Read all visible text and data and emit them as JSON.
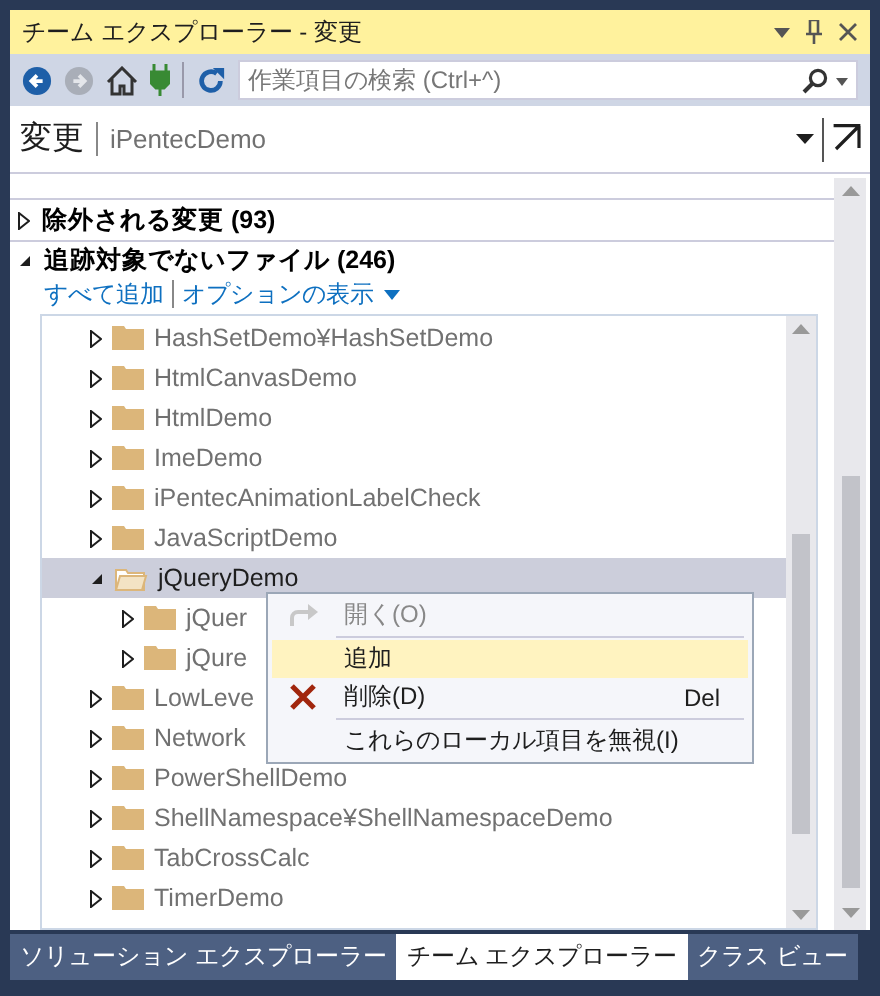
{
  "window": {
    "title": "チーム エクスプローラー - 変更"
  },
  "search": {
    "placeholder": "作業項目の検索 (Ctrl+^)"
  },
  "header": {
    "title": "変更",
    "repository": "iPentecDemo"
  },
  "sections": [
    {
      "label": "除外される変更 (93)",
      "expanded": false
    },
    {
      "label": "追跡対象でないファイル (246)",
      "expanded": true,
      "links": [
        "すべて追加",
        "オプションの表示"
      ]
    }
  ],
  "tree": [
    {
      "label": "HashSetDemo¥HashSetDemo",
      "expanded": false,
      "selected": false
    },
    {
      "label": "HtmlCanvasDemo",
      "expanded": false,
      "selected": false
    },
    {
      "label": "HtmlDemo",
      "expanded": false,
      "selected": false
    },
    {
      "label": "ImeDemo",
      "expanded": false,
      "selected": false
    },
    {
      "label": "iPentecAnimationLabelCheck",
      "expanded": false,
      "selected": false
    },
    {
      "label": "JavaScriptDemo",
      "expanded": false,
      "selected": false
    },
    {
      "label": "jQueryDemo",
      "expanded": true,
      "selected": true,
      "children": [
        {
          "label": "jQuer",
          "expanded": false,
          "selected": false
        },
        {
          "label": "jQure",
          "expanded": false,
          "selected": false
        }
      ]
    },
    {
      "label": "LowLeve",
      "expanded": false,
      "selected": false
    },
    {
      "label": "Network",
      "expanded": false,
      "selected": false
    },
    {
      "label": "PowerShellDemo",
      "expanded": false,
      "selected": false
    },
    {
      "label": "ShellNamespace¥ShellNamespaceDemo",
      "expanded": false,
      "selected": false
    },
    {
      "label": "TabCrossCalc",
      "expanded": false,
      "selected": false
    },
    {
      "label": "TimerDemo",
      "expanded": false,
      "selected": false
    }
  ],
  "context_menu": [
    {
      "label": "開く(O)",
      "kind": "redo",
      "disabled": true,
      "selected": false,
      "separator_after": true
    },
    {
      "label": "追加",
      "kind": "plain",
      "disabled": false,
      "selected": true,
      "separator_after": false
    },
    {
      "label": "削除(D)",
      "kind": "delete",
      "shortcut": "Del",
      "disabled": false,
      "selected": false,
      "separator_after": true
    },
    {
      "label": "これらのローカル項目を無視(I)",
      "kind": "plain",
      "disabled": false,
      "selected": false,
      "separator_after": false
    }
  ],
  "tabs": [
    {
      "label": "ソリューション エクスプローラー",
      "selected": false
    },
    {
      "label": "チーム エクスプローラー",
      "selected": true
    },
    {
      "label": "クラス ビュー",
      "selected": false
    }
  ]
}
